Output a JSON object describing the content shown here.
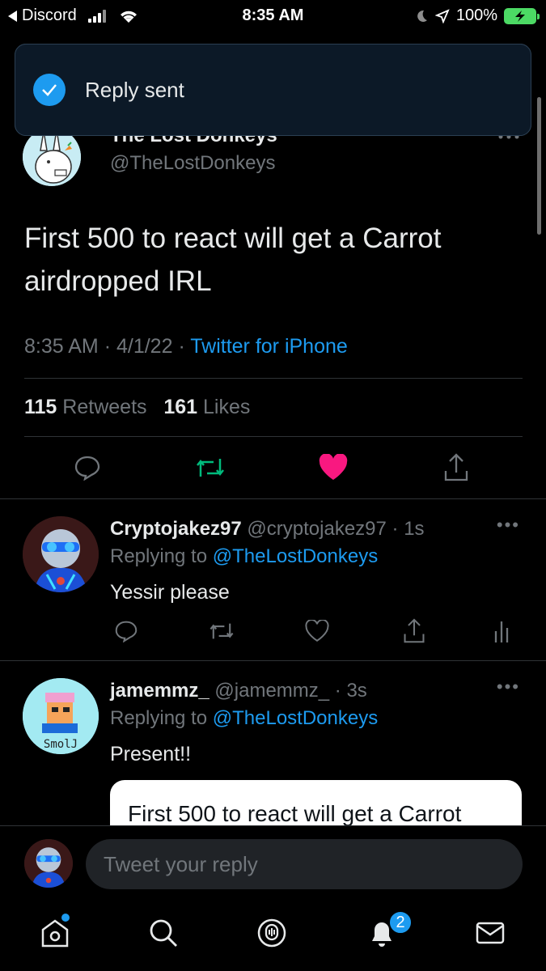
{
  "status_bar": {
    "back_app": "Discord",
    "time": "8:35 AM",
    "battery": "100%"
  },
  "toast": {
    "text": "Reply sent"
  },
  "tweet": {
    "author_name": "The Lost Donkeys",
    "author_handle": "@TheLostDonkeys",
    "text": "First 500 to react will get a Carrot airdropped IRL",
    "time": "8:35 AM",
    "date": "4/1/22",
    "separator": "·",
    "source": "Twitter for iPhone",
    "retweets_count": "115",
    "retweets_label": "Retweets",
    "likes_count": "161",
    "likes_label": "Likes",
    "liked": true
  },
  "replies": [
    {
      "name": "Cryptojakez97",
      "handle": "@cryptojakez97",
      "time": "· 1s",
      "replying_prefix": "Replying to",
      "replying_to": "@TheLostDonkeys",
      "text": "Yessir please"
    },
    {
      "name": "jamemmz_",
      "handle": "@jamemmz_",
      "time": "· 3s",
      "replying_prefix": "Replying to",
      "replying_to": "@TheLostDonkeys",
      "text": "Present!!",
      "avatar_text": "SmolJ",
      "quote_text": "First 500 to react will get a Carrot"
    }
  ],
  "composer": {
    "placeholder": "Tweet your reply"
  },
  "tabbar": {
    "notifications_badge": "2"
  },
  "colors": {
    "accent": "#1d9bf0",
    "like": "#f91880",
    "retweet": "#00ba7c",
    "background": "#000000"
  }
}
